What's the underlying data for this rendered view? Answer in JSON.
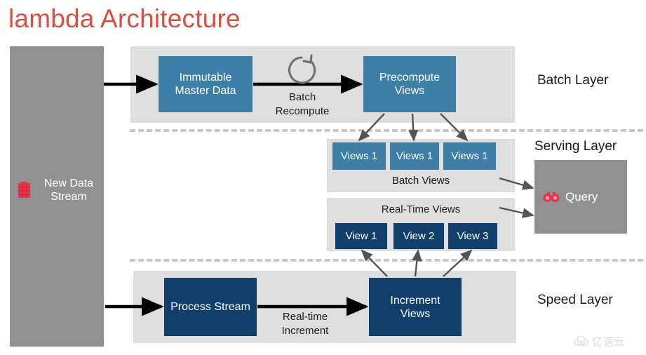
{
  "title": "lambda Architecture",
  "colors": {
    "title": "#d9503f",
    "panel_gray": "#919191",
    "band_gray": "#dedede",
    "node_blue": "#3d7fa6",
    "node_navy": "#103f6b",
    "accent_red": "#e8334a",
    "divider": "#c9c9c9"
  },
  "stream": {
    "label": "New Data\nStream",
    "label_line1": "New Data",
    "label_line2": "Stream",
    "icon": "database-icon"
  },
  "batch_layer": {
    "title": "Batch Layer",
    "master_node": "Immutable\nMaster Data",
    "master_line1": "Immutable",
    "master_line2": "Master Data",
    "precompute_node": "Precompute\nViews",
    "precompute_line1": "Precompute",
    "precompute_line2": "Views",
    "edge_label": "Batch\nRecompute",
    "edge_line1": "Batch",
    "edge_line2": "Recompute",
    "loop_icon": "refresh-loop-icon"
  },
  "serving_layer": {
    "title": "Serving Layer",
    "batch_views_caption": "Batch Views",
    "batch_views": [
      "Views 1",
      "Views 1",
      "Views 1"
    ],
    "realtime_views_caption": "Real-Time Views",
    "realtime_views": [
      "View 1",
      "View 2",
      "View 3"
    ],
    "query": {
      "label": "Query",
      "icon": "binoculars-icon"
    }
  },
  "speed_layer": {
    "title": "Speed Layer",
    "process_node": "Process Stream",
    "increment_node": "Increment\nViews",
    "increment_line1": "Increment",
    "increment_line2": "Views",
    "edge_label": "Real-time\nIncrement",
    "edge_line1": "Real-time",
    "edge_line2": "Increment"
  },
  "watermark": {
    "text": "亿速云",
    "icon": "cloud-icon"
  }
}
